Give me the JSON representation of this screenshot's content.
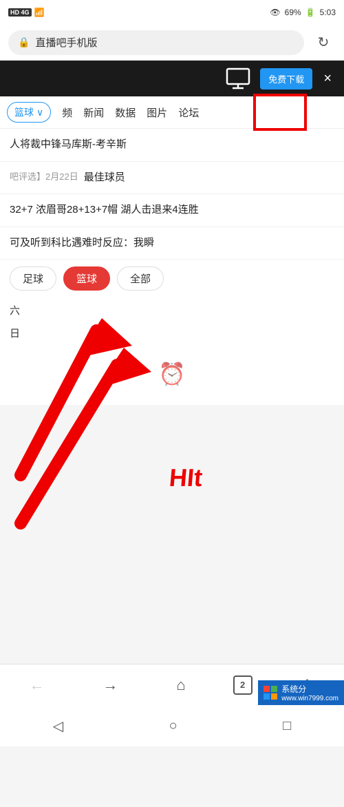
{
  "statusBar": {
    "left": "HD 4G",
    "signal": "4G",
    "time": "5:03",
    "battery": "69%",
    "batteryIcon": "🔋"
  },
  "addressBar": {
    "url": "直播吧手机版",
    "lockColor": "#4CAF50",
    "refreshIcon": "↻"
  },
  "darkBanner": {
    "downloadBtn": "免费下载",
    "closeIcon": "×",
    "monitorIcon": "🖥"
  },
  "navTabs": {
    "dropdown": "篮球",
    "items": [
      "频",
      "新闻",
      "数据",
      "图片",
      "论坛"
    ]
  },
  "news": [
    {
      "text": "人将裁中锋马库斯-考辛斯"
    },
    {
      "date": "吧评选】2月22日",
      "text": "最佳球员"
    },
    {
      "text": "32+7 浓眉哥28+13+7帽 湖人击退来4连胜"
    },
    {
      "text": "可及听到科比遇难时反应：我瞬"
    }
  ],
  "filterRow": {
    "buttons": [
      "足球",
      "篮球",
      "全部"
    ],
    "active": "篮球"
  },
  "dateLabels": [
    "六",
    "日"
  ],
  "highlightBox": {
    "label": "monitor-icon-highlight"
  },
  "browserNav": {
    "back": "←",
    "forward": "→",
    "home": "⌂",
    "tabs": "2",
    "menu": "⋮"
  },
  "androidNav": {
    "back": "◁",
    "home": "○",
    "recents": "□"
  },
  "watermark": {
    "text": "系统分",
    "url": "www.win7999.com"
  }
}
